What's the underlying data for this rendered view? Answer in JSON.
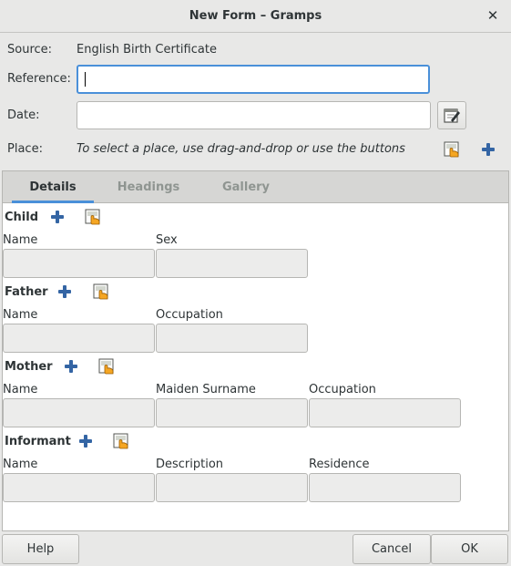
{
  "window": {
    "title": "New Form – Gramps",
    "close_symbol": "✕"
  },
  "header": {
    "source_label": "Source:",
    "source_value": "English Birth Certificate",
    "reference_label": "Reference:",
    "reference_value": "",
    "date_label": "Date:",
    "date_value": "",
    "place_label": "Place:",
    "place_hint": "To select a place, use drag-and-drop or use the buttons"
  },
  "tabs": [
    {
      "label": "Details",
      "active": true
    },
    {
      "label": "Headings",
      "active": false
    },
    {
      "label": "Gallery",
      "active": false
    }
  ],
  "sections": {
    "child": {
      "title": "Child",
      "columns": [
        "Name",
        "Sex"
      ]
    },
    "father": {
      "title": "Father",
      "columns": [
        "Name",
        "Occupation"
      ]
    },
    "mother": {
      "title": "Mother",
      "columns": [
        "Name",
        "Maiden Surname",
        "Occupation"
      ]
    },
    "informant": {
      "title": "Informant",
      "columns": [
        "Name",
        "Description",
        "Residence"
      ]
    }
  },
  "buttons": {
    "help": "Help",
    "cancel": "Cancel",
    "ok": "OK"
  },
  "colors": {
    "accent": "#4a90d9",
    "add_icon": "#3465a4",
    "select_icon": "#f5a623"
  }
}
